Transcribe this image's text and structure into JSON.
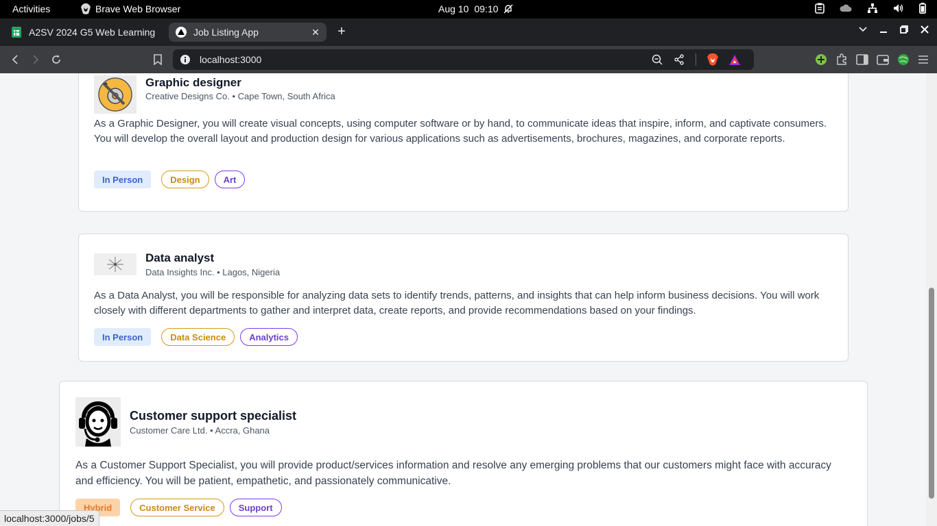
{
  "system_bar": {
    "activities": "Activities",
    "app_name": "Brave Web Browser",
    "date": "Aug 10",
    "time": "09:10"
  },
  "tabs": [
    {
      "title": "A2SV 2024 G5 Web Learning",
      "active": false
    },
    {
      "title": "Job Listing App",
      "active": true
    }
  ],
  "omnibox": {
    "url": "localhost:3000"
  },
  "jobs": [
    {
      "title": "Graphic designer",
      "company": "Creative Designs Co.",
      "location": "Cape Town, South Africa",
      "separator": "•",
      "description": "As a Graphic Designer, you will create visual concepts, using computer software or by hand, to communicate ideas that inspire, inform, and captivate consumers. You will develop the overall layout and production design for various applications such as advertisements, brochures, magazines, and corporate reports.",
      "mode": "In Person",
      "categories": [
        "Design",
        "Art"
      ],
      "logo": "gear-pencil-icon"
    },
    {
      "title": "Data analyst",
      "company": "Data Insights Inc.",
      "location": "Lagos, Nigeria",
      "separator": "•",
      "description": "As a Data Analyst, you will be responsible for analyzing data sets to identify trends, patterns, and insights that can help inform business decisions. You will work closely with different departments to gather and interpret data, create reports, and provide recommendations based on your findings.",
      "mode": "In Person",
      "categories": [
        "Data Science",
        "Analytics"
      ],
      "logo": "network-node-icon"
    },
    {
      "title": "Customer support specialist",
      "company": "Customer Care Ltd.",
      "location": "Accra, Ghana",
      "separator": "•",
      "description": "As a Customer Support Specialist, you will provide product/services information and resolve any emerging problems that our customers might face with accuracy and efficiency. You will be patient, empathetic, and passionately communicative.",
      "mode": "Hybrid",
      "categories": [
        "Customer Service",
        "Support"
      ],
      "logo": "headset-agent-icon"
    }
  ],
  "status_url": "localhost:3000/jobs/5",
  "colors": {
    "in_person_bg": "#e0ecfb",
    "in_person_text": "#3b63c9",
    "hybrid_bg": "#fcd3a8",
    "hybrid_text": "#e07a2f",
    "category1": "#c98a10",
    "category2": "#6d3fc9"
  }
}
